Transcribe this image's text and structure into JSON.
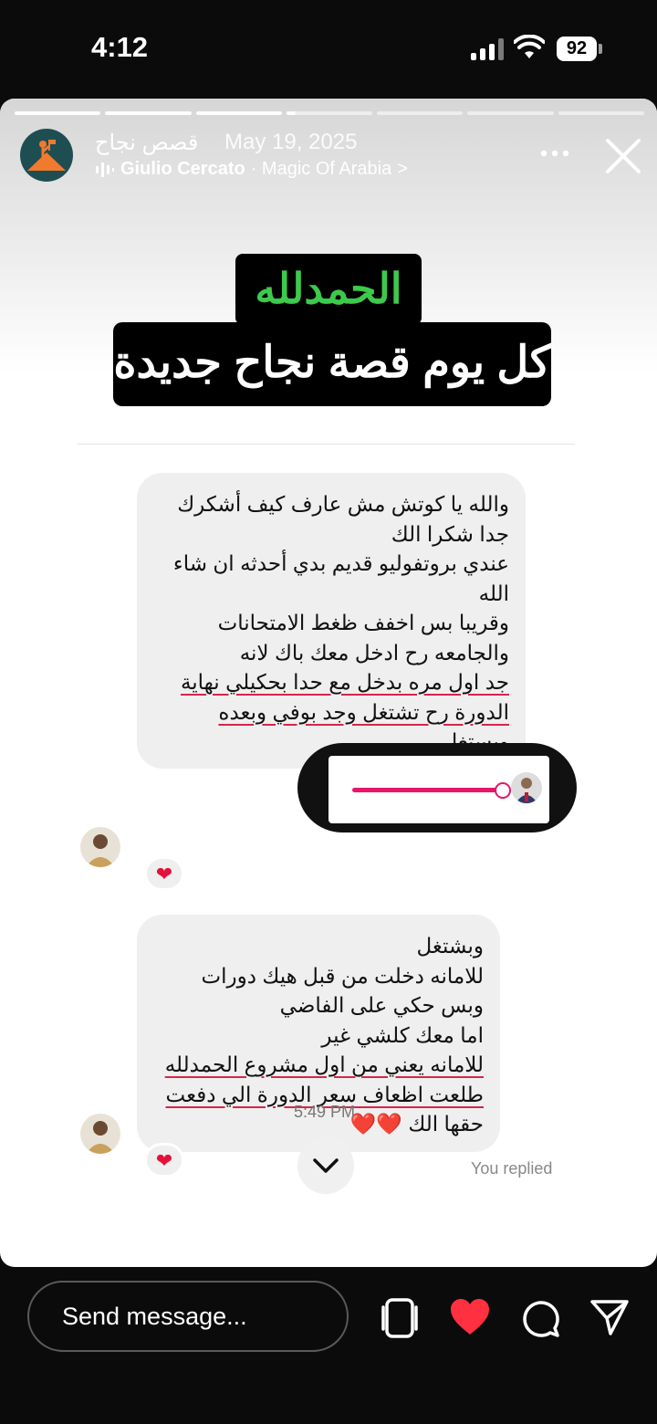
{
  "status_bar": {
    "time": "4:12",
    "battery": "92"
  },
  "story": {
    "account_name": "قصص نجاح",
    "date": "May 19, 2025",
    "music_artist": "Giulio Cercato",
    "music_title": "· Magic Of Arabia",
    "music_chevron": ">",
    "progress": {
      "segments": 7,
      "completed": 3,
      "current_fraction": 0.1
    },
    "overlay": {
      "heading": "الحمدلله",
      "tagline": "كل يوم قصة نجاح جديدة"
    },
    "dm": {
      "message1": [
        "والله يا كوتش مش عارف كيف أشكرك",
        "جدا شكرا الك",
        "عندي بروتفوليو قديم بدي أحدثه ان شاء",
        "الله",
        "وقريبا بس اخفف ظغط الامتحانات",
        "والجامعه رح ادخل معك باك لانه",
        "جد اول مره بدخل مع حدا بحكيلي نهاية",
        "الدورة رح تشتغل وجد بوفي وبعده",
        "وبستغل"
      ],
      "message2": [
        "وبشتغل",
        "للامانه دخلت من قبل هيك دورات",
        "وبس حكي على الفاضي",
        "اما معك كلشي غير",
        "للامانه يعني من اول مشروع الحمدلله",
        "طلعت اظعاف سعر الدورة الي دفعت",
        "حقها الك ❤️❤️"
      ],
      "reaction": "❤",
      "time": "5:49 PM",
      "you_replied": "You replied",
      "slider_level": 0.95
    }
  },
  "bottom_bar": {
    "placeholder": "Send message..."
  },
  "colors": {
    "heading_green": "#3dca4b",
    "slider_pink": "#e61668",
    "like_red": "#ff3040"
  }
}
